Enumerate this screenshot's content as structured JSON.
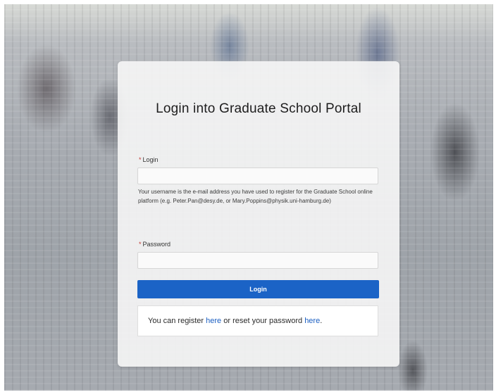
{
  "background": {
    "description_icon": "campus-crowd-photo"
  },
  "login_card": {
    "title": "Login into Graduate School Portal",
    "login": {
      "required_marker": "*",
      "label": "Login",
      "value": "",
      "help_text": "Your username is the e-mail address you have used to register for the Graduate School online platform (e.g. Peter.Pan@desy.de, or Mary.Poppins@physik.uni-hamburg.de)"
    },
    "password": {
      "required_marker": "*",
      "label": "Password",
      "value": ""
    },
    "login_button": "Login",
    "register_box": {
      "prefix": "You can register ",
      "register_link": "here",
      "middle": " or reset your password ",
      "reset_link": "here",
      "suffix": "."
    }
  },
  "colors": {
    "button": "#1b63c6",
    "link": "#1b5fc2",
    "required": "#c23934"
  }
}
